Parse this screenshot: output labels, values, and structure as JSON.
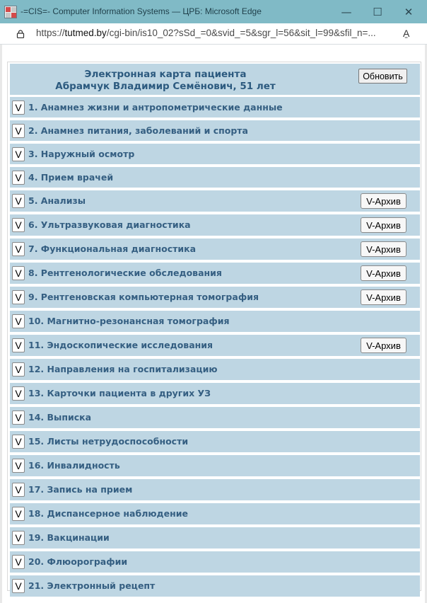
{
  "window": {
    "title": "-=CIS=- Computer Information Systems — ЦРБ: Microsoft Edge",
    "url_prefix": "https://",
    "url_host": "tutmed.by",
    "url_path": "/cgi-bin/is10_02?sSd_=0&svid_=5&sgr_l=56&sit_l=99&sfil_n=...",
    "minimize": "—",
    "maximize": "☐",
    "close": "✕",
    "read_aloud": "A̱"
  },
  "card": {
    "title": "Электронная карта пациента",
    "patient": "Абрамчук Владимир Семёнович, 51 лет",
    "refresh_label": "Обновить"
  },
  "sections": [
    {
      "expand": "V",
      "label": "1. Анамнез жизни и антропометрические данные"
    },
    {
      "expand": "V",
      "label": "2. Анамнез питания, заболеваний и спорта"
    },
    {
      "expand": "V",
      "label": "3. Наружный осмотр"
    },
    {
      "expand": "V",
      "label": "4. Прием врачей"
    },
    {
      "expand": "V",
      "label": "5. Анализы",
      "archive": "V-Архив"
    },
    {
      "expand": "V",
      "label": "6. Ультразвуковая диагностика",
      "archive": "V-Архив"
    },
    {
      "expand": "V",
      "label": "7. Функциональная диагностика",
      "archive": "V-Архив"
    },
    {
      "expand": "V",
      "label": "8. Рентгенологические обследования",
      "archive": "V-Архив"
    },
    {
      "expand": "V",
      "label": "9. Рентгеновская компьютерная томография",
      "archive": "V-Архив"
    },
    {
      "expand": "V",
      "label": "10. Магнитно-резонансная томография"
    },
    {
      "expand": "V",
      "label": "11. Эндоскопические исследования",
      "archive": "V-Архив"
    },
    {
      "expand": "V",
      "label": "12. Направления на госпитализацию"
    },
    {
      "expand": "V",
      "label": "13. Карточки пациента в других УЗ"
    },
    {
      "expand": "V",
      "label": "14. Выписка"
    },
    {
      "expand": "V",
      "label": "15. Листы нетрудоспособности"
    },
    {
      "expand": "V",
      "label": "16. Инвалидность"
    },
    {
      "expand": "V",
      "label": "17. Запись на прием"
    },
    {
      "expand": "V",
      "label": "18. Диспансерное наблюдение"
    },
    {
      "expand": "V",
      "label": "19. Вакцинации"
    },
    {
      "expand": "V",
      "label": "20. Флюорографии"
    },
    {
      "expand": "V",
      "label": "21. Электронный рецепт"
    }
  ],
  "colors": {
    "titlebar": "#80bac6",
    "row_background": "#bed6e3",
    "heading_text": "#2c5a7f",
    "row_text": "#355f82"
  }
}
